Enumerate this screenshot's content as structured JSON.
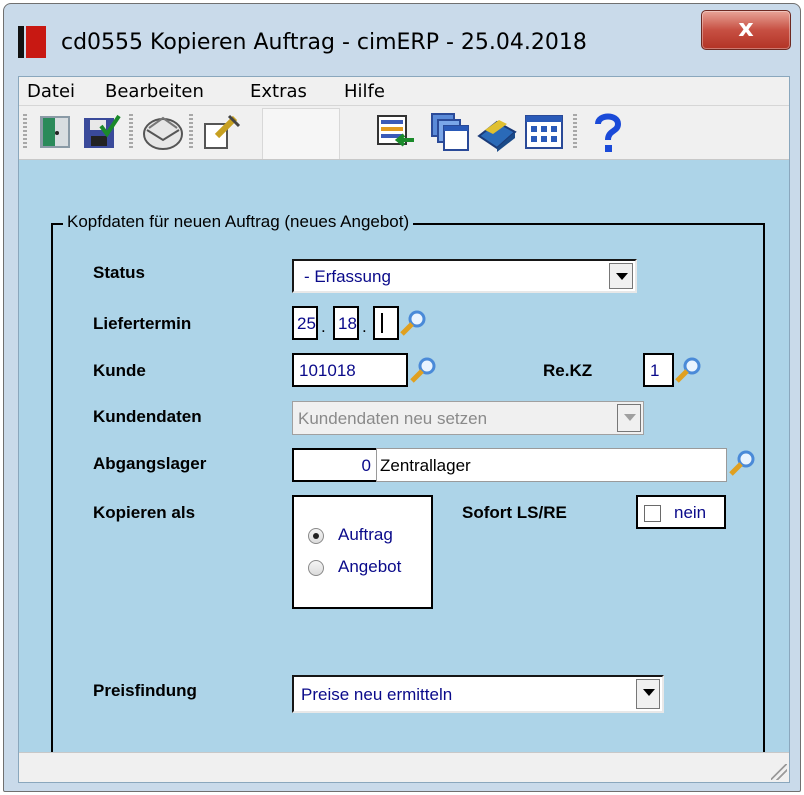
{
  "window": {
    "title": "cd0555 Kopieren Auftrag - cimERP - 25.04.2018",
    "close_glyph": "x"
  },
  "menu": {
    "items": [
      "Datei",
      "Bearbeiten",
      "Extras",
      "Hilfe"
    ]
  },
  "toolbar": {
    "buttons": [
      "exit-door-icon",
      "save-check-icon",
      "mail-icon",
      "edit-document-icon",
      "transfer-list-icon",
      "windows-cascade-icon",
      "book-icon",
      "grid-table-icon",
      "help-icon"
    ]
  },
  "form": {
    "group_label": "Kopfdaten für neuen Auftrag (neues Angebot)",
    "status": {
      "label": "Status",
      "value": "- Erfassung"
    },
    "liefertermin": {
      "label": "Liefertermin",
      "day": "25",
      "month": "18",
      "year": "",
      "sep": "."
    },
    "kunde": {
      "label": "Kunde",
      "value": "101018"
    },
    "rekz": {
      "label": "Re.KZ",
      "value": "1"
    },
    "kundendaten": {
      "label": "Kundendaten",
      "value": "Kundendaten neu setzen",
      "disabled": true
    },
    "abgangslager": {
      "label": "Abgangslager",
      "number": "0",
      "name": "Zentrallager"
    },
    "kopieren_als": {
      "label": "Kopieren als",
      "options": [
        "Auftrag",
        "Angebot"
      ],
      "selected": "Auftrag"
    },
    "sofort": {
      "label": "Sofort LS/RE",
      "value": "nein",
      "checked": false
    },
    "preisfindung": {
      "label": "Preisfindung",
      "value": "Preise neu ermitteln"
    }
  },
  "colors": {
    "client_bg": "#add4e8",
    "field_text": "#0a0a8a",
    "close_btn": "#c75043",
    "icon_red": "#c81812"
  }
}
